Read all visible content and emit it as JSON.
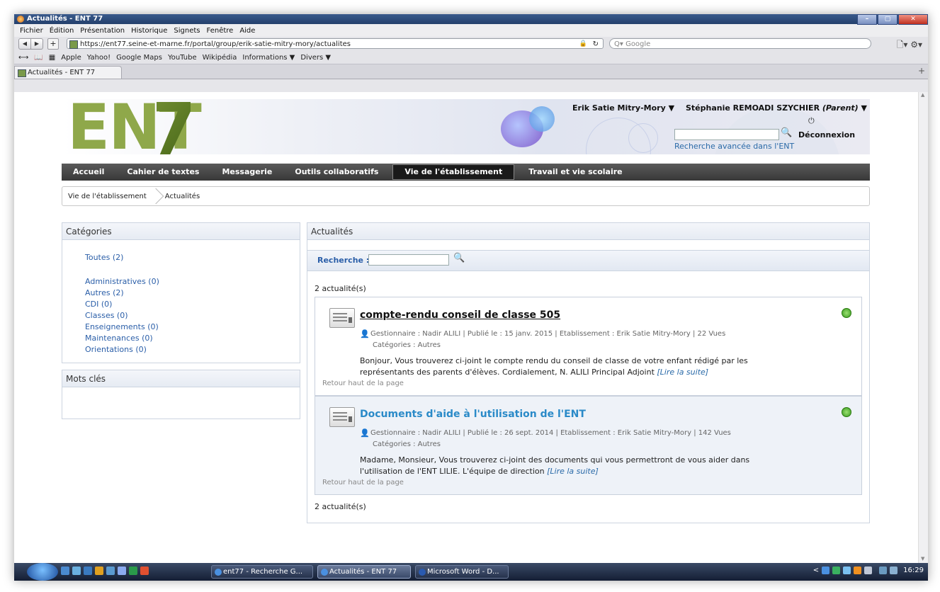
{
  "window": {
    "title": "Actualités - ENT 77",
    "controls": [
      "–",
      "▢",
      "✕"
    ]
  },
  "menu": [
    "Fichier",
    "Édition",
    "Présentation",
    "Historique",
    "Signets",
    "Fenêtre",
    "Aide"
  ],
  "nav": {
    "back": "◀",
    "forward": "▶",
    "new_tab": "+",
    "url": "https://ent77.seine-et-marne.fr/portal/group/erik-satie-mitry-mory/actualites",
    "search_placeholder": "Q▾ Google",
    "right": "🗋▾ ⚙▾"
  },
  "bookmarks": [
    "Apple",
    "Yahoo!",
    "Google Maps",
    "YouTube",
    "Wikipédia",
    "Informations ▼",
    "Divers ▼"
  ],
  "tab": {
    "label": "Actualités - ENT 77"
  },
  "header": {
    "logo_text": "ENT",
    "school": "Erik Satie Mitry-Mory ▼",
    "user_name": "Stéphanie REMOADI SZYCHIER ",
    "user_role": "(Parent)",
    "user_arrow": " ▼",
    "logout": "Déconnexion",
    "advanced_search": "Recherche avancée dans l'ENT"
  },
  "mainnav": [
    "Accueil",
    "Cahier de textes",
    "Messagerie",
    "Outils collaboratifs",
    "Vie de l'établissement",
    "Travail et vie scolaire"
  ],
  "breadcrumb": [
    "Vie de l'établissement",
    "Actualités"
  ],
  "categories": {
    "title": "Catégories",
    "all": "Toutes (2)",
    "items": [
      "Administratives (0)",
      "Autres (2)",
      "CDI (0)",
      "Classes (0)",
      "Enseignements (0)",
      "Maintenances (0)",
      "Orientations (0)"
    ]
  },
  "keywords": {
    "title": "Mots clés"
  },
  "news": {
    "title": "Actualités",
    "search_label": "Recherche :",
    "count": "2 actualité(s)",
    "articles": [
      {
        "title": "compte-rendu conseil de classe 505",
        "meta": "Gestionnaire : Nadir ALILI | Publié le : 15 janv. 2015 | Etablissement : Erik Satie Mitry-Mory | 22 Vues",
        "categories": "Catégories : Autres",
        "body": "Bonjour, Vous trouverez ci-joint le compte rendu du conseil de classe de votre enfant rédigé par les représentants des parents d'élèves. Cordialement, N. ALILI Principal Adjoint ",
        "more": "[Lire la suite]",
        "back_top": "Retour haut de la page"
      },
      {
        "title": "Documents d'aide à l'utilisation de l'ENT",
        "meta": "Gestionnaire : Nadir ALILI | Publié le : 26 sept. 2014 | Etablissement : Erik Satie Mitry-Mory | 142 Vues",
        "categories": "Catégories : Autres",
        "body": "Madame, Monsieur, Vous trouverez ci-joint des documents qui vous permettront de vous aider dans l'utilisation de l'ENT LILIE. L'équipe de direction ",
        "more": "[Lire la suite]",
        "back_top": "Retour haut de la page"
      }
    ]
  },
  "taskbar": {
    "tasks": [
      "ent77 - Recherche G...",
      "Actualités - ENT 77",
      "Microsoft Word - D..."
    ],
    "time": "16:29"
  },
  "colors": {
    "accent": "#2a5ea8",
    "logo_green": "#8fa84a",
    "nav_bg": "#383838"
  }
}
